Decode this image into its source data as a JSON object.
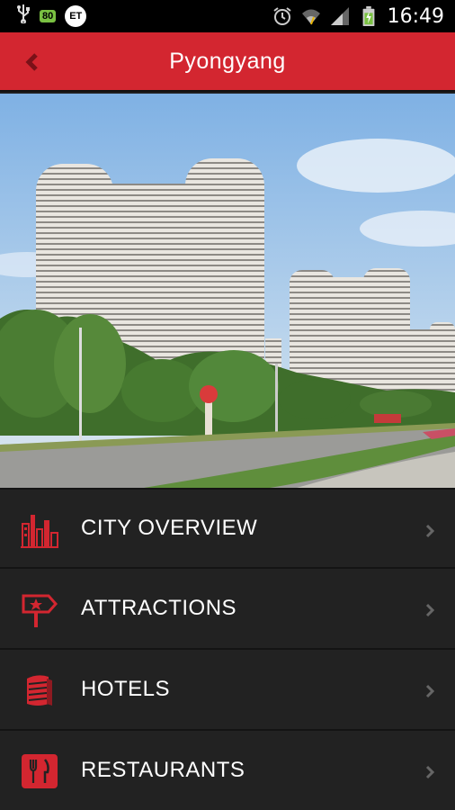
{
  "status_bar": {
    "battery_badge": "80",
    "carrier_badge": "ET",
    "time": "16:49",
    "icons": [
      "usb-icon",
      "alarm-icon",
      "wifi-icon",
      "signal-icon",
      "battery-charging-icon"
    ]
  },
  "action_bar": {
    "title": "Pyongyang",
    "back_icon": "chevron-left-icon",
    "color": "#d32630"
  },
  "hero": {
    "image": "city-skyline-photo"
  },
  "menu": {
    "items": [
      {
        "label": "CITY OVERVIEW",
        "icon": "city-skyline-icon"
      },
      {
        "label": "ATTRACTIONS",
        "icon": "signpost-star-icon"
      },
      {
        "label": "HOTELS",
        "icon": "hotel-building-icon"
      },
      {
        "label": "RESTAURANTS",
        "icon": "fork-knife-icon"
      }
    ],
    "accent_color": "#d32630"
  }
}
